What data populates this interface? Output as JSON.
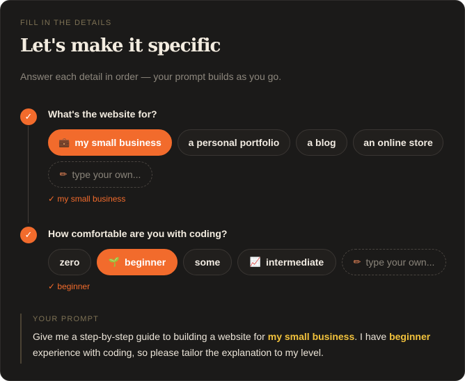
{
  "header": {
    "eyebrow": "FILL IN THE DETAILS",
    "title": "Let's make it specific",
    "subtitle": "Answer each detail in order — your prompt builds as you go."
  },
  "steps": [
    {
      "check": "✓",
      "question": "What's the website for?",
      "options": [
        {
          "label": "my small business",
          "icon": "briefcase-icon",
          "glyph": "💼",
          "selected": true
        },
        {
          "label": "a personal portfolio",
          "selected": false
        },
        {
          "label": "a blog",
          "selected": false
        },
        {
          "label": "an online store",
          "selected": false
        }
      ],
      "custom": {
        "label": "type your own...",
        "icon": "pencil-icon",
        "glyph": "✏"
      },
      "selected_note": "✓ my small business"
    },
    {
      "check": "✓",
      "question": "How comfortable are you with coding?",
      "options": [
        {
          "label": "zero",
          "selected": false
        },
        {
          "label": "beginner",
          "icon": "sprout-icon",
          "glyph": "🌱",
          "selected": true
        },
        {
          "label": "some",
          "selected": false
        },
        {
          "label": "intermediate",
          "icon": "chart-icon",
          "glyph": "📈",
          "selected": false
        }
      ],
      "custom": {
        "label": "type your own...",
        "icon": "pencil-icon",
        "glyph": "✏"
      },
      "selected_note": "✓ beginner"
    }
  ],
  "prompt": {
    "label": "YOUR PROMPT",
    "part1": "Give me a step-by-step guide to building a website for ",
    "highlight1": "my small business",
    "part2": ". I have ",
    "highlight2": "beginner",
    "part3": " experience with coding, so please tailor the explanation to my level."
  },
  "colors": {
    "background": "#1b1a19",
    "accent": "#f26b2c",
    "highlight": "#f2c23c",
    "text": "#f3ece0",
    "muted": "#8d877d"
  }
}
